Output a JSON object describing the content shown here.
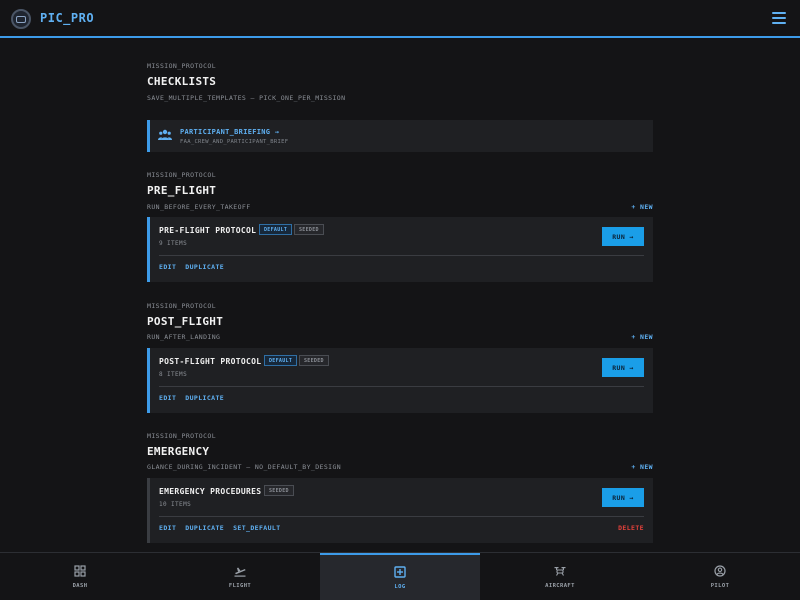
{
  "app": {
    "title": "PIC_PRO"
  },
  "page": {
    "eyebrow": "MISSION_PROTOCOL",
    "title": "CHECKLISTS",
    "subtitle": "SAVE_MULTIPLE_TEMPLATES — PICK_ONE_PER_MISSION"
  },
  "briefing": {
    "title": "PARTICIPANT_BRIEFING →",
    "subtitle": "FAA_CREW_AND_PARTICIPANT_BRIEF"
  },
  "labels": {
    "new": "+ NEW",
    "run": "RUN →",
    "edit": "EDIT",
    "duplicate": "DUPLICATE",
    "set_default": "SET_DEFAULT",
    "delete": "DELETE",
    "default_badge": "DEFAULT",
    "seeded_badge": "SEEDED"
  },
  "sections": [
    {
      "eyebrow": "MISSION_PROTOCOL",
      "title": "PRE_FLIGHT",
      "subtitle": "RUN_BEFORE_EVERY_TAKEOFF",
      "card": {
        "name": "PRE-FLIGHT PROTOCOL",
        "items": "9 ITEMS"
      }
    },
    {
      "eyebrow": "MISSION_PROTOCOL",
      "title": "POST_FLIGHT",
      "subtitle": "RUN_AFTER_LANDING",
      "card": {
        "name": "POST-FLIGHT PROTOCOL",
        "items": "8 ITEMS"
      }
    },
    {
      "eyebrow": "MISSION_PROTOCOL",
      "title": "EMERGENCY",
      "subtitle": "GLANCE_DURING_INCIDENT — NO_DEFAULT_BY_DESIGN",
      "card": {
        "name": "EMERGENCY PROCEDURES",
        "items": "10 ITEMS"
      }
    }
  ],
  "nav": [
    {
      "label": "DASH",
      "icon": "grid-icon"
    },
    {
      "label": "FLIGHT",
      "icon": "plane-departure-icon"
    },
    {
      "label": "LOG",
      "icon": "plus-square-icon",
      "active": true
    },
    {
      "label": "AIRCRAFT",
      "icon": "drone-icon"
    },
    {
      "label": "PILOT",
      "icon": "user-circle-icon"
    }
  ],
  "colors": {
    "accent": "#3d9be9",
    "run_button": "#1a9ee8",
    "delete": "#e5413b",
    "background": "#141416",
    "card": "#1f2023"
  }
}
